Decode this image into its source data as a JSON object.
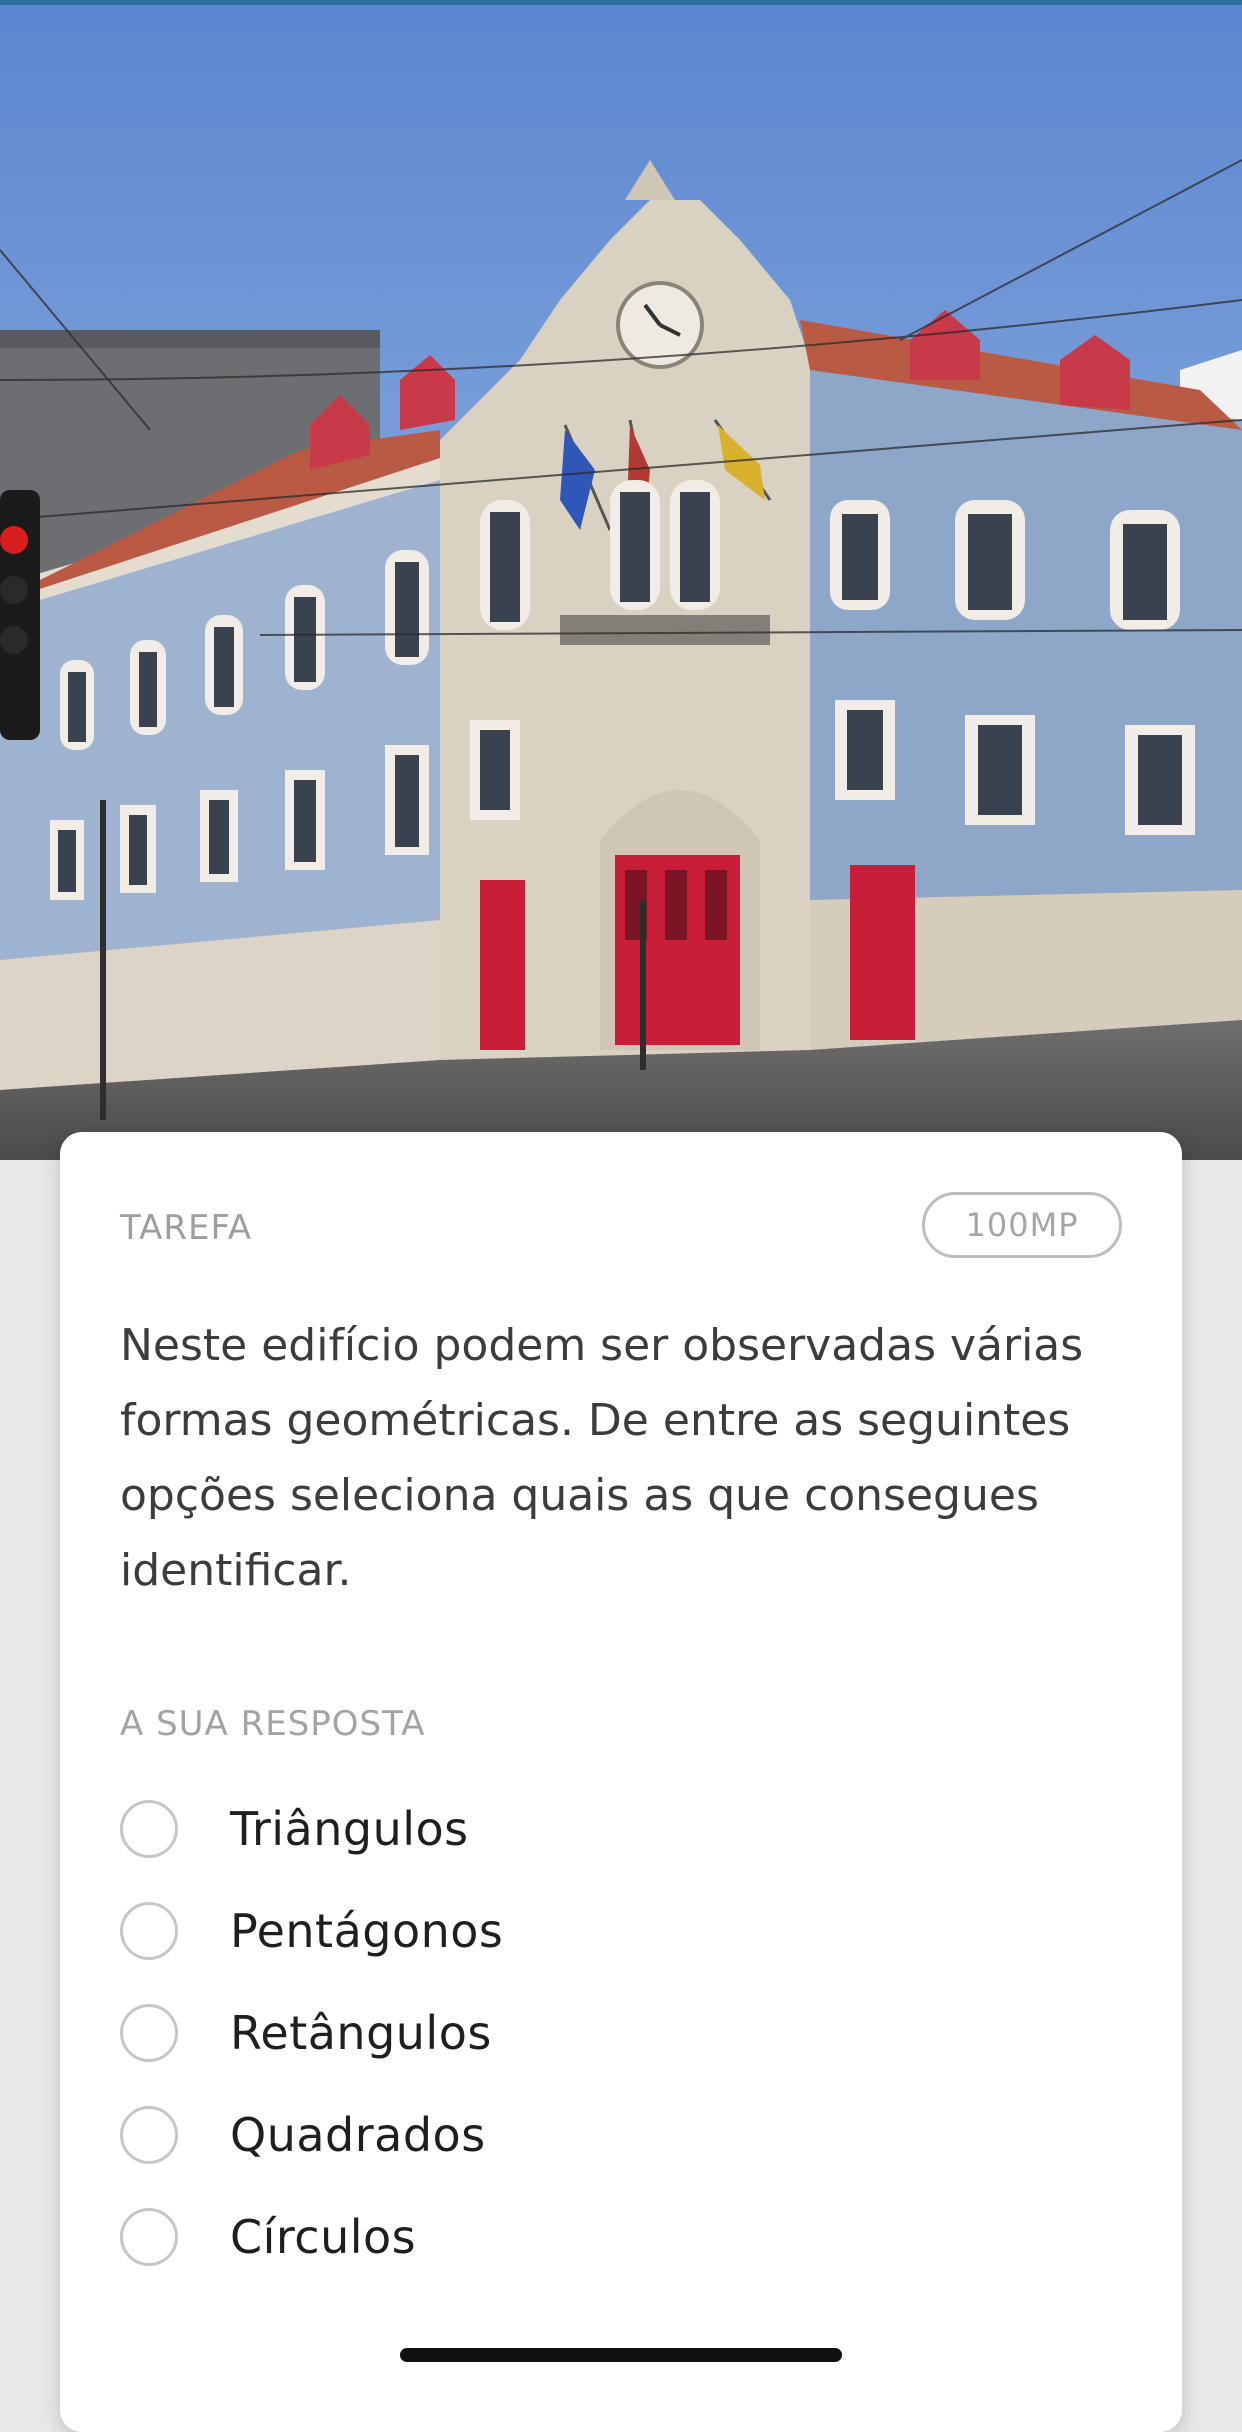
{
  "task": {
    "label": "TAREFA",
    "points": "100MP",
    "question": "Neste edifício podem ser observadas várias formas geométricas. De entre as seguintes opções seleciona quais as que consegues identificar."
  },
  "answer": {
    "label": "A SUA RESPOSTA",
    "options": [
      {
        "label": "Triângulos"
      },
      {
        "label": "Pentágonos"
      },
      {
        "label": "Retângulos"
      },
      {
        "label": "Quadrados"
      },
      {
        "label": "Círculos"
      }
    ]
  },
  "photo": {
    "subject": "building-photo"
  }
}
